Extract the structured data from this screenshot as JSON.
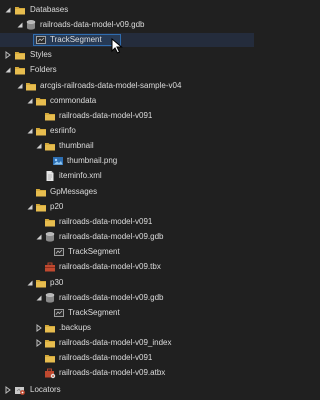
{
  "tree": {
    "databases_label": "Databases",
    "gdb_top_label": "railroads-data-model-v09.gdb",
    "tracksegment_top_label": "TrackSegment",
    "styles_label": "Styles",
    "folders_label": "Folders",
    "sample_folder_label": "arcgis-railroads-data-model-sample-v04",
    "commondata_label": "commondata",
    "rr091_a_label": "railroads-data-model-v091",
    "esriinfo_label": "esriinfo",
    "thumbnail_label": "thumbnail",
    "thumbnail_png_label": "thumbnail.png",
    "iteminfo_label": "iteminfo.xml",
    "gpmessages_label": "GpMessages",
    "p20_label": "p20",
    "rr091_b_label": "railroads-data-model-v091",
    "gdb_p20_label": "railroads-data-model-v09.gdb",
    "tracksegment_p20_label": "TrackSegment",
    "tbx_label": "railroads-data-model-v09.tbx",
    "p30_label": "p30",
    "gdb_p30_label": "railroads-data-model-v09.gdb",
    "tracksegment_p30_label": "TrackSegment",
    "backups_label": ".backups",
    "index_label": "railroads-data-model-v09_index",
    "rr091_c_label": "railroads-data-model-v091",
    "atbx_label": "railroads-data-model-v09.atbx",
    "locators_label": "Locators"
  },
  "colors": {
    "background": "#202020",
    "text": "#dcdcdc",
    "selection_border": "#2f6cae",
    "folder": "#d4a93a",
    "database": "#8a8a8a",
    "toolbox": "#c0492f"
  },
  "icons": {
    "expanded": "triangle-down-icon",
    "collapsed": "triangle-right-icon",
    "folder": "folder-icon",
    "database": "geodatabase-icon",
    "feature_class": "feature-class-icon",
    "image": "image-file-icon",
    "file": "file-icon",
    "toolbox": "toolbox-icon",
    "locator": "locator-icon",
    "style": "style-icon"
  }
}
